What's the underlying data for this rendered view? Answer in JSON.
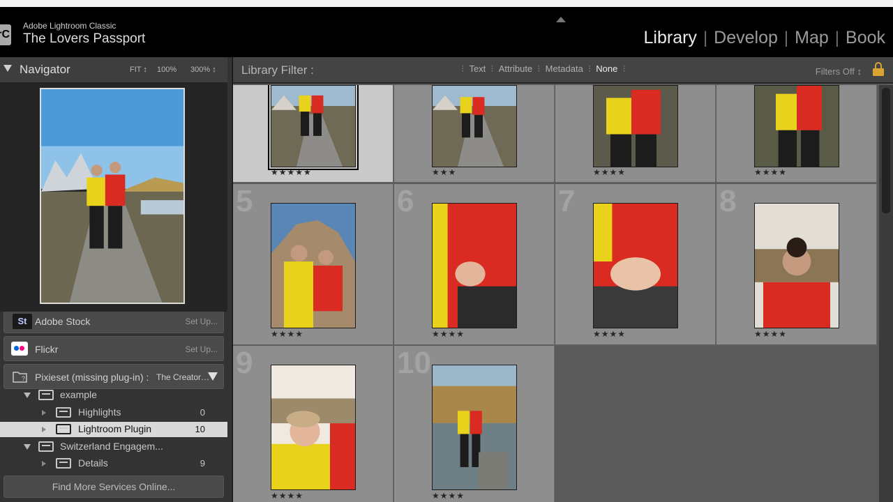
{
  "header": {
    "app_name": "Adobe Lightroom Classic",
    "catalog_name": "The Lovers Passport",
    "badge": "rC",
    "modules": [
      {
        "label": "Library",
        "active": true
      },
      {
        "label": "Develop",
        "active": false
      },
      {
        "label": "Map",
        "active": false
      },
      {
        "label": "Book",
        "active": false
      }
    ]
  },
  "navigator": {
    "title": "Navigator",
    "zoom_fit": "FIT ↕",
    "zoom_100": "100%",
    "zoom_300": "300% ↕"
  },
  "publish_services": {
    "adobe_stock": {
      "label": "Adobe Stock",
      "setup": "Set Up...",
      "icon": "St"
    },
    "flickr": {
      "label": "Flickr",
      "setup": "Set Up..."
    },
    "pixieset": {
      "label": "Pixieset (missing plug-in) :",
      "account": "The Creator…"
    },
    "tree": [
      {
        "label": "example",
        "count": ""
      },
      {
        "label": "Highlights",
        "count": "0"
      },
      {
        "label": "Lightroom Plugin",
        "count": "10"
      },
      {
        "label": "Switzerland Engagem...",
        "count": ""
      },
      {
        "label": "Details",
        "count": "9"
      }
    ],
    "find_more": "Find More Services Online..."
  },
  "library_filter": {
    "label": "Library Filter :",
    "options": [
      {
        "label": "Text",
        "active": false
      },
      {
        "label": "Attribute",
        "active": false
      },
      {
        "label": "Metadata",
        "active": false
      },
      {
        "label": "None",
        "active": true
      }
    ],
    "filters_status": "Filters Off ↕"
  },
  "grid": {
    "cells": [
      {
        "number": "",
        "rating": "★★★★★",
        "selected": true
      },
      {
        "number": "",
        "rating": "★★★",
        "selected": false
      },
      {
        "number": "",
        "rating": "★★★★",
        "selected": false
      },
      {
        "number": "",
        "rating": "★★★★",
        "selected": false
      },
      {
        "number": "5",
        "rating": "★★★★",
        "selected": false
      },
      {
        "number": "6",
        "rating": "★★★★",
        "selected": false
      },
      {
        "number": "7",
        "rating": "★★★★",
        "selected": false
      },
      {
        "number": "8",
        "rating": "★★★★",
        "selected": false
      },
      {
        "number": "9",
        "rating": "★★★★",
        "selected": false
      },
      {
        "number": "10",
        "rating": "★★★★",
        "selected": false
      }
    ]
  },
  "colors": {
    "accent_lock": "#d7a530",
    "selection": "#d9d9d9",
    "jacket_yellow": "#e8d21c",
    "jacket_red": "#d92b22"
  }
}
